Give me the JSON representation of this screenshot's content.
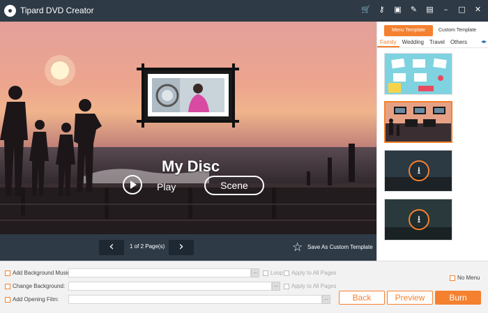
{
  "app": {
    "title": "Tipard DVD Creator",
    "accent_color": "#f4812f",
    "titlebar_color": "#2e3a46",
    "toolbar_icons": [
      "cart-icon",
      "key-icon",
      "save-icon",
      "feedback-icon",
      "message-icon",
      "minimize-icon",
      "maximize-icon",
      "close-icon"
    ]
  },
  "preview": {
    "disc_title": "My Disc",
    "play_label": "Play",
    "scene_label": "Scene"
  },
  "pagebar": {
    "page_label": "1 of 2 Page(s)",
    "save_template_label": "Save As Custom Template"
  },
  "templates": {
    "tabs": [
      "Menu Template",
      "Custom Template"
    ],
    "categories": [
      "Family",
      "Wedding",
      "Travel",
      "Others"
    ],
    "active_category": "Family"
  },
  "options": {
    "bg_music_label": "Add Background Music:",
    "change_bg_label": "Change Background:",
    "opening_film_label": "Add Opening Film:",
    "loop_label": "Loop",
    "apply_all_label": "Apply to All Pages",
    "no_menu_label": "No Menu",
    "dots": "..."
  },
  "actions": {
    "back": "Back",
    "preview": "Preview",
    "burn": "Burn"
  }
}
